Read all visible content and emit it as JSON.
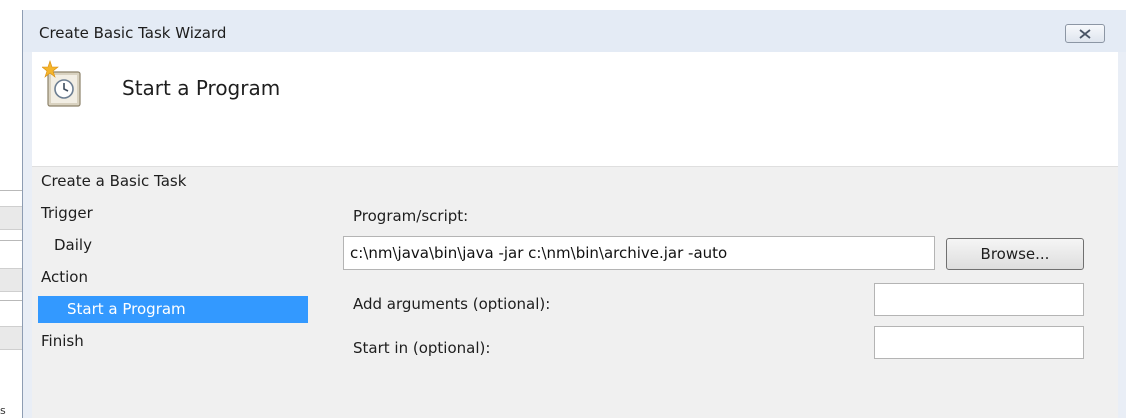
{
  "background_app": {
    "clipped_text": "s"
  },
  "window": {
    "title": "Create Basic Task Wizard",
    "close_icon": "close-icon"
  },
  "header": {
    "title": "Start a Program",
    "icon": "task-scheduler-clock-icon"
  },
  "nav": {
    "items": [
      {
        "label": "Create a Basic Task",
        "level": 0,
        "selected": false
      },
      {
        "label": "Trigger",
        "level": 0,
        "selected": false
      },
      {
        "label": "Daily",
        "level": 1,
        "selected": false
      },
      {
        "label": "Action",
        "level": 0,
        "selected": false
      },
      {
        "label": "Start a Program",
        "level": 1,
        "selected": true
      },
      {
        "label": "Finish",
        "level": 0,
        "selected": false
      }
    ]
  },
  "form": {
    "program_label": "Program/script:",
    "program_value": "c:\\nm\\java\\bin\\java -jar c:\\nm\\bin\\archive.jar -auto",
    "browse_label": "Browse...",
    "arguments_label": "Add arguments (optional):",
    "arguments_value": "",
    "start_in_label": "Start in (optional):",
    "start_in_value": ""
  },
  "colors": {
    "selection": "#3399ff",
    "titlebar": "#e4ebf5",
    "client": "#f0f0f0"
  }
}
